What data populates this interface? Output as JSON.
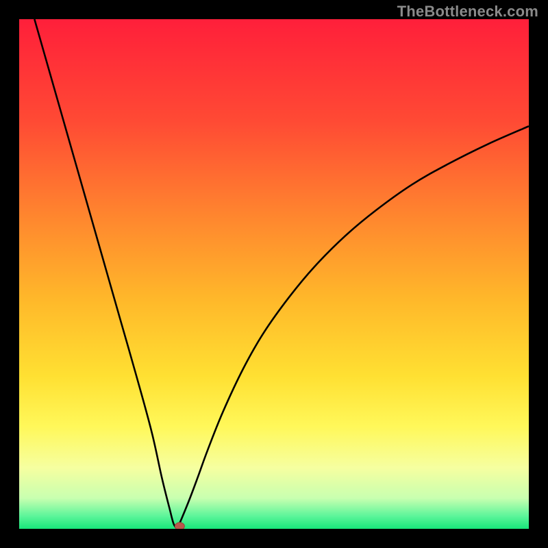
{
  "watermark": "TheBottleneck.com",
  "colors": {
    "frame": "#000000",
    "curve": "#000000",
    "marker_fill": "#b8584c",
    "marker_stroke": "#9c4238",
    "gradient_stops": [
      {
        "offset": 0.0,
        "color": "#ff1f3a"
      },
      {
        "offset": 0.2,
        "color": "#ff4a34"
      },
      {
        "offset": 0.4,
        "color": "#ff8a2e"
      },
      {
        "offset": 0.55,
        "color": "#ffb82a"
      },
      {
        "offset": 0.7,
        "color": "#ffe032"
      },
      {
        "offset": 0.8,
        "color": "#fff85a"
      },
      {
        "offset": 0.88,
        "color": "#f6ffa0"
      },
      {
        "offset": 0.94,
        "color": "#c8ffb0"
      },
      {
        "offset": 0.975,
        "color": "#5cf59a"
      },
      {
        "offset": 1.0,
        "color": "#18e67a"
      }
    ]
  },
  "chart_data": {
    "type": "line",
    "title": "",
    "xlabel": "",
    "ylabel": "",
    "xlim": [
      0,
      100
    ],
    "ylim": [
      0,
      100
    ],
    "minimum_x": 31,
    "marker": {
      "x": 31.5,
      "y": 0.5
    },
    "left_branch": {
      "x": [
        3,
        5,
        8,
        11,
        14,
        17,
        20,
        23,
        26,
        28,
        29.5,
        30.3,
        31
      ],
      "y": [
        100,
        93,
        82.5,
        72,
        61.5,
        51,
        40.5,
        30,
        19,
        10,
        4,
        1,
        0
      ]
    },
    "right_branch": {
      "x": [
        31,
        32,
        33.5,
        35,
        37,
        40,
        44,
        48,
        53,
        58,
        64,
        70,
        77,
        84,
        92,
        100
      ],
      "y": [
        0,
        2.3,
        6,
        10,
        15.5,
        23,
        31.5,
        38.5,
        45.5,
        51.5,
        57.5,
        62.5,
        67.5,
        71.5,
        75.5,
        79
      ]
    }
  }
}
